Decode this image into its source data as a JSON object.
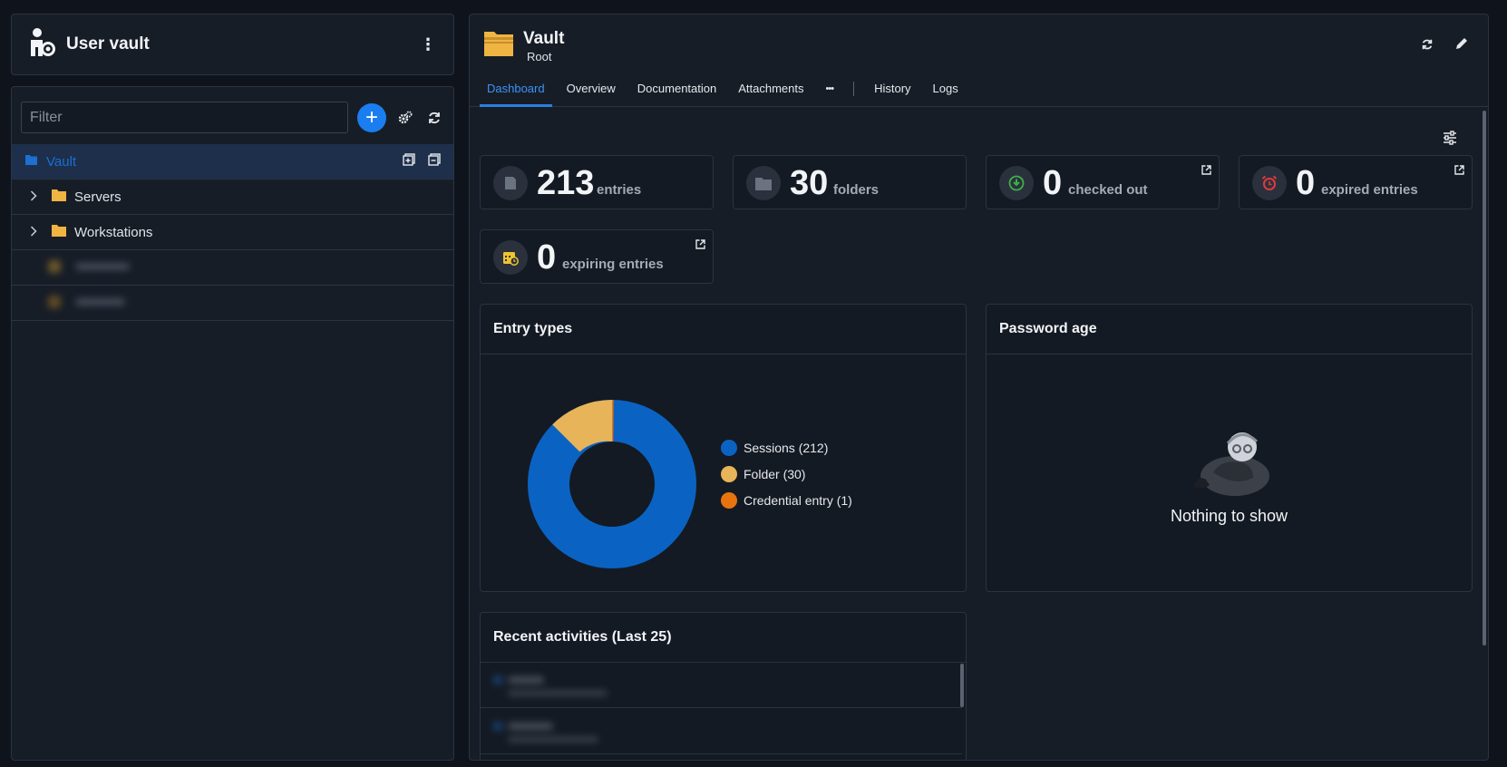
{
  "left_header": {
    "title": "User vault"
  },
  "tree": {
    "filter_placeholder": "Filter",
    "items": [
      {
        "label": "Vault",
        "selected": true
      },
      {
        "label": "Servers"
      },
      {
        "label": "Workstations"
      }
    ]
  },
  "main": {
    "title": "Vault",
    "subtitle": "Root",
    "tabs": [
      {
        "label": "Dashboard",
        "active": true
      },
      {
        "label": "Overview"
      },
      {
        "label": "Documentation"
      },
      {
        "label": "Attachments"
      },
      {
        "label": "•••"
      },
      {
        "label": "History"
      },
      {
        "label": "Logs"
      }
    ]
  },
  "stats": [
    {
      "value": "213",
      "label": "entries"
    },
    {
      "value": "30",
      "label": "folders"
    },
    {
      "value": "0",
      "label": "checked out"
    },
    {
      "value": "0",
      "label": "expired entries"
    },
    {
      "value": "0",
      "label": "expiring entries"
    }
  ],
  "entry_types": {
    "title": "Entry types",
    "legend": [
      {
        "label": "Sessions (212)",
        "color": "#0a63c2"
      },
      {
        "label": "Folder (30)",
        "color": "#e8b459"
      },
      {
        "label": "Credential entry (1)",
        "color": "#e8740f"
      }
    ]
  },
  "password_age": {
    "title": "Password age",
    "empty_text": "Nothing to show"
  },
  "recent": {
    "title": "Recent activities (Last 25)"
  },
  "colors": {
    "accent": "#1a7ef0",
    "selected_bg": "#1d2f4a",
    "folder": "#f0b443"
  }
}
